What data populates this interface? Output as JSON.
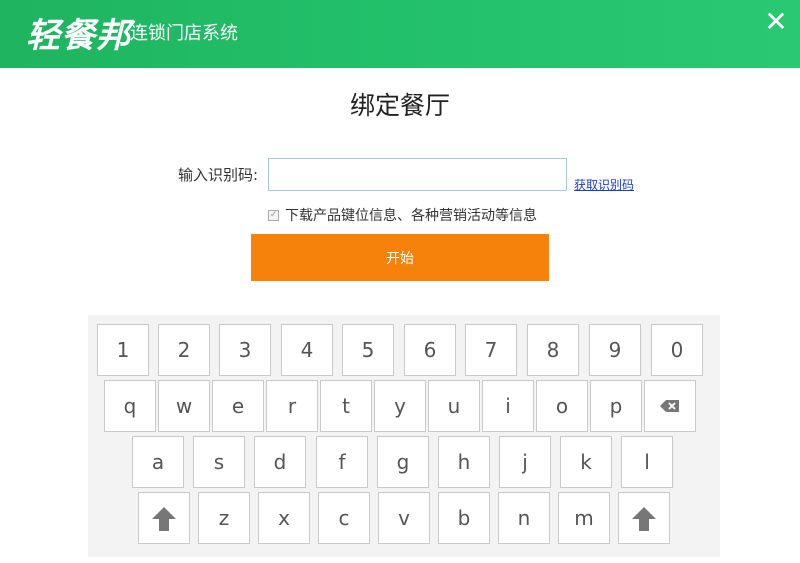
{
  "header": {
    "logo": "轻餐邦",
    "subtitle": "连锁门店系统",
    "close_icon": "close-icon",
    "colors": {
      "bg": "#22bb66"
    }
  },
  "page": {
    "title": "绑定餐厅"
  },
  "form": {
    "code_label": "输入识别码:",
    "code_value": "",
    "code_placeholder": "",
    "get_code_link": "获取识别码",
    "checkbox_checked": true,
    "checkbox_label": "下载产品键位信息、各种营销活动等信息",
    "start_button": "开始"
  },
  "keyboard": {
    "row1": [
      "1",
      "2",
      "3",
      "4",
      "5",
      "6",
      "7",
      "8",
      "9",
      "0"
    ],
    "row2": [
      "q",
      "w",
      "e",
      "r",
      "t",
      "y",
      "u",
      "i",
      "o",
      "p"
    ],
    "row3": [
      "a",
      "s",
      "d",
      "f",
      "g",
      "h",
      "j",
      "k",
      "l"
    ],
    "row4": [
      "z",
      "x",
      "c",
      "v",
      "b",
      "n",
      "m"
    ],
    "backspace_icon": "backspace-icon",
    "shift_icon": "shift-icon"
  },
  "colors": {
    "accent": "#f6820c",
    "header": "#22bb66"
  }
}
